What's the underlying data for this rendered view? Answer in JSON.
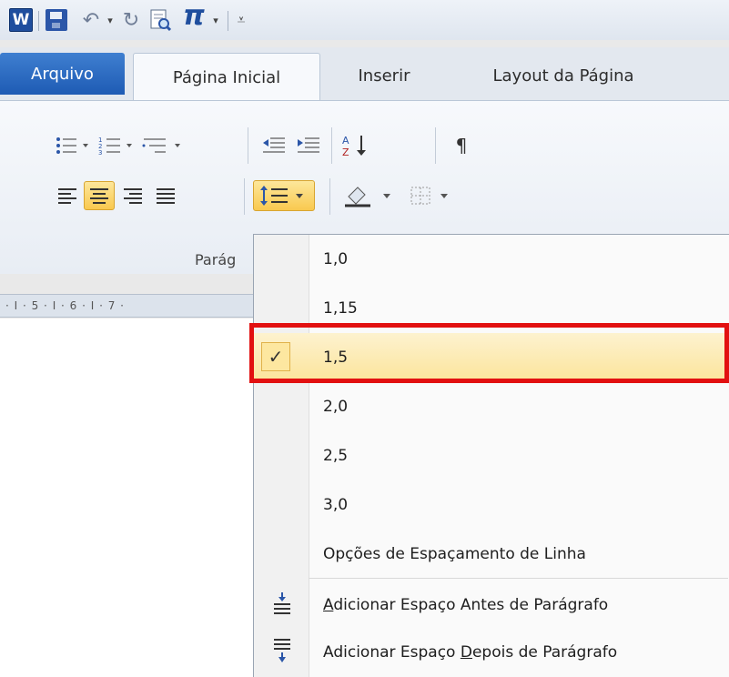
{
  "qat": {
    "app_logo": "W",
    "dropdown_arrow": "▾",
    "customize_arrow": "⩡",
    "icons": [
      "word-logo",
      "save-icon",
      "undo-icon",
      "redo-icon",
      "print-preview-icon",
      "equation-icon"
    ]
  },
  "tabs": {
    "file": "Arquivo",
    "home": "Página Inicial",
    "insert": "Inserir",
    "layout": "Layout da Página"
  },
  "ribbon": {
    "group_label": "Parág",
    "ruler_text": "· I · 5 · I · 6 · I · 7 ·",
    "paragraph_mark": "¶"
  },
  "menu": {
    "spacing_options": [
      "1,0",
      "1,15",
      "1,5",
      "2,0",
      "2,5",
      "3,0"
    ],
    "selected_value": "1,5",
    "check_glyph": "✓",
    "line_spacing_options": "Opções de Espaçamento de Linha",
    "add_before_prefix": "A",
    "add_before_rest": "dicionar Espaço Antes de Parágrafo",
    "add_after_prefix": "Adicionar Espaço ",
    "add_after_accel": "D",
    "add_after_rest": "epois de Parágrafo"
  },
  "colors": {
    "file_tab": "#1e5bb4",
    "active_button": "#f9c94f",
    "highlight_border": "#e21010",
    "selected_item": "#fce49a"
  }
}
